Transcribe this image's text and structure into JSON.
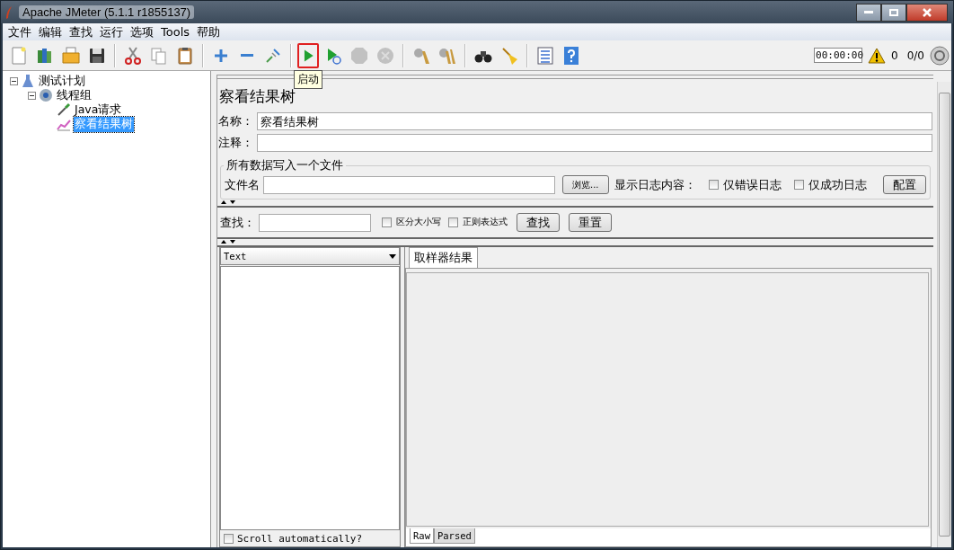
{
  "window": {
    "title": "Apache JMeter (5.1.1 r1855137)"
  },
  "menu": [
    "文件",
    "编辑",
    "查找",
    "运行",
    "选项",
    "Tools",
    "帮助"
  ],
  "toolbar": {
    "groups": [
      [
        {
          "kind": "new",
          "disabled": false,
          "highlighted": false
        },
        {
          "kind": "templates",
          "disabled": false,
          "highlighted": false
        },
        {
          "kind": "open",
          "disabled": false,
          "highlighted": false
        },
        {
          "kind": "save",
          "disabled": false,
          "highlighted": false
        }
      ],
      [
        {
          "kind": "cut",
          "disabled": false,
          "highlighted": false
        },
        {
          "kind": "copy",
          "disabled": false,
          "highlighted": false
        },
        {
          "kind": "paste",
          "disabled": false,
          "highlighted": false
        }
      ],
      [
        {
          "kind": "expand",
          "disabled": false,
          "highlighted": false
        },
        {
          "kind": "collapse",
          "disabled": false,
          "highlighted": false
        },
        {
          "kind": "toggle",
          "disabled": false,
          "highlighted": false
        }
      ],
      [
        {
          "kind": "start",
          "disabled": false,
          "highlighted": true
        },
        {
          "kind": "start-no-pause",
          "disabled": false,
          "highlighted": false
        },
        {
          "kind": "stop",
          "disabled": true,
          "highlighted": false
        },
        {
          "kind": "shutdown",
          "disabled": true,
          "highlighted": false
        }
      ],
      [
        {
          "kind": "clear",
          "disabled": false,
          "highlighted": false
        },
        {
          "kind": "clear-all",
          "disabled": false,
          "highlighted": false
        }
      ],
      [
        {
          "kind": "search",
          "disabled": false,
          "highlighted": false
        },
        {
          "kind": "reset-search",
          "disabled": false,
          "highlighted": false
        }
      ],
      [
        {
          "kind": "functions",
          "disabled": false,
          "highlighted": false
        },
        {
          "kind": "help",
          "disabled": false,
          "highlighted": false
        }
      ]
    ],
    "tooltip": "启动",
    "timer": "00:00:00",
    "warnings": "0",
    "threads": "0/0"
  },
  "tree": [
    {
      "label": "测试计划",
      "kind": "plan",
      "expanded": true,
      "selected": false,
      "children": [
        {
          "label": "线程组",
          "kind": "thread-group",
          "expanded": true,
          "selected": false,
          "children": [
            {
              "label": "Java请求",
              "kind": "sampler",
              "selected": false
            },
            {
              "label": "察看结果树",
              "kind": "listener",
              "selected": true
            }
          ]
        }
      ]
    }
  ],
  "editor": {
    "title": "察看结果树",
    "name_label": "名称：",
    "name_value": "察看结果树",
    "comment_label": "注释：",
    "file_group": {
      "title": "所有数据写入一个文件",
      "file_label": "文件名",
      "browse": "浏览...",
      "log_label": "显示日志内容：",
      "options": [
        {
          "label": "仅错误日志",
          "checked": false
        },
        {
          "label": "仅成功日志",
          "checked": false
        }
      ],
      "configure": "配置"
    },
    "search": {
      "label": "查找：",
      "options": [
        {
          "label": "区分大小写",
          "checked": false
        },
        {
          "label": "正则表达式",
          "checked": false
        }
      ],
      "buttons": [
        "查找",
        "重置"
      ]
    },
    "results": {
      "renderer": "Text",
      "tabs": [
        {
          "label": "取样器结果",
          "selected": true
        }
      ],
      "scroll_label": "Scroll automatically?",
      "scroll_checked": false,
      "view_tabs": [
        {
          "label": "Raw",
          "selected": true
        },
        {
          "label": "Parsed",
          "selected": false
        }
      ]
    }
  }
}
